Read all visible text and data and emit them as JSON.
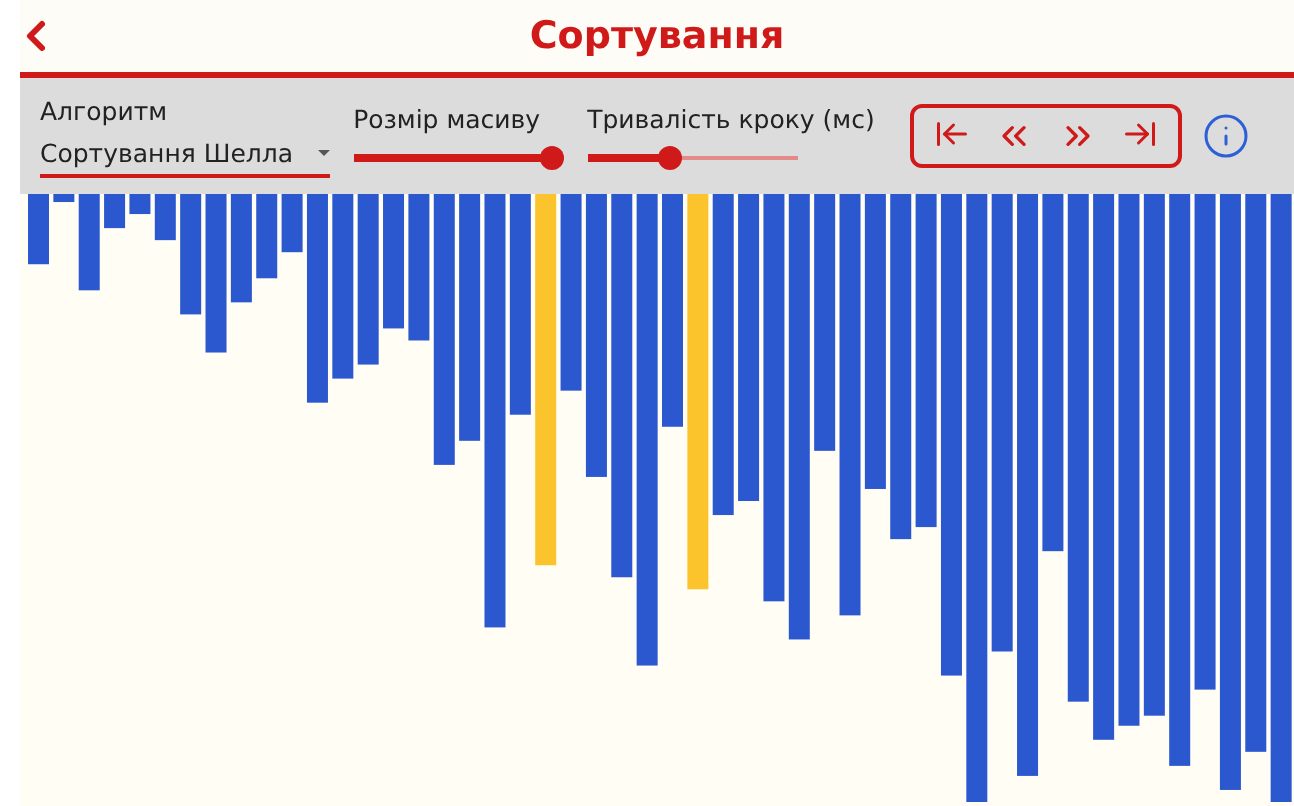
{
  "header": {
    "title": "Сортування"
  },
  "toolbar": {
    "algorithm": {
      "label": "Алгоритм",
      "value": "Сортування Шелла"
    },
    "sliders": [
      {
        "label": "Розмір масиву",
        "level": 1.0
      },
      {
        "label": "Тривалість кроку (мс)",
        "level": 0.38
      }
    ]
  }
}
